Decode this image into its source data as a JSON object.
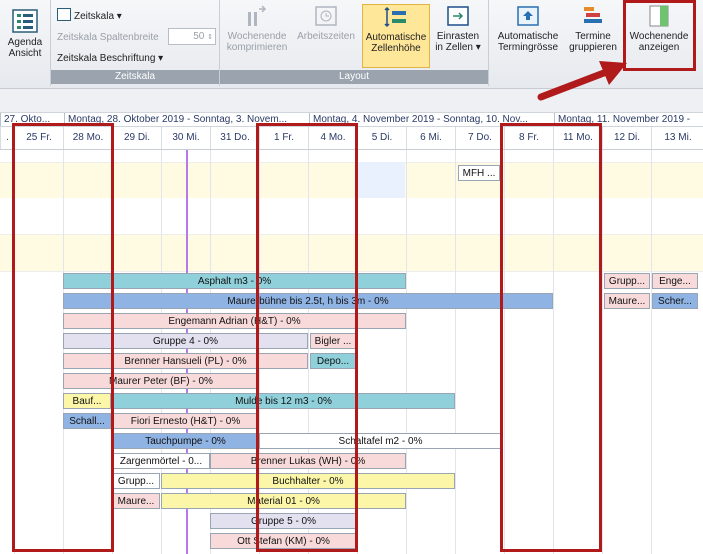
{
  "ribbon": {
    "agenda": {
      "label1": "Agenda",
      "label2": "Ansicht"
    },
    "zeitskala": {
      "menu_label": "Zeitskala",
      "spaltenbreite_label": "Zeitskala Spaltenbreite",
      "spaltenbreite_value": "50",
      "beschriftung_label": "Zeitskala Beschriftung",
      "group_label": "Zeitskala"
    },
    "layout": {
      "group_label": "Layout",
      "buttons": [
        {
          "l1": "Wochenende",
          "l2": "komprimieren"
        },
        {
          "l1": "Arbeitszeiten",
          "l2": ""
        },
        {
          "l1": "Automatische",
          "l2": "Zellenhöhe"
        },
        {
          "l1": "Einrasten",
          "l2": "in Zellen"
        }
      ]
    },
    "more": [
      {
        "l1": "Automatische",
        "l2": "Termingrösse"
      },
      {
        "l1": "Termine",
        "l2": "gruppieren"
      },
      {
        "l1": "Wochenende",
        "l2": "anzeigen"
      }
    ]
  },
  "weeks": [
    {
      "label": "27. Okto..."
    },
    {
      "label": "Montag, 28. Oktober 2019 - Sonntag, 3. Novem..."
    },
    {
      "label": "Montag, 4. November 2019 - Sonntag, 10. Nov..."
    },
    {
      "label": "Montag, 11. November 2019 -"
    }
  ],
  "days": [
    "25 Fr.",
    "28 Mo.",
    "29 Di.",
    "30 Mi.",
    "31 Do.",
    "1 Fr.",
    "4 Mo.",
    "5 Di.",
    "6 Mi.",
    "7 Do.",
    "8 Fr.",
    "11 Mo.",
    "12 Di.",
    "13 Mi."
  ],
  "bars": [
    {
      "text": "MFH ..."
    },
    {
      "text": "Asphalt m3 - 0%"
    },
    {
      "text": "Grupp..."
    },
    {
      "text": "Enge..."
    },
    {
      "text": "Maurerbühne bis 2.5t, h bis 3m - 0%"
    },
    {
      "text": "Maure..."
    },
    {
      "text": "Scher..."
    },
    {
      "text": "Engemann Adrian (H&T) - 0%"
    },
    {
      "text": "Gruppe 4 - 0%"
    },
    {
      "text": "Bigler ..."
    },
    {
      "text": "Brenner Hansueli (PL) - 0%"
    },
    {
      "text": "Depo..."
    },
    {
      "text": "Maurer Peter (BF) - 0%"
    },
    {
      "text": "Bauf..."
    },
    {
      "text": "Mulde bis 12 m3 - 0%"
    },
    {
      "text": "Schall..."
    },
    {
      "text": "Fiori Ernesto (H&T) - 0%"
    },
    {
      "text": "Tauchpumpe - 0%"
    },
    {
      "text": "Schaltafel m2 - 0%"
    },
    {
      "text": "Zargenmörtel - 0..."
    },
    {
      "text": "Brenner Lukas (WH) - 0%"
    },
    {
      "text": "Grupp..."
    },
    {
      "text": "Buchhalter - 0%"
    },
    {
      "text": "Maure..."
    },
    {
      "text": "Material 01 - 0%"
    },
    {
      "text": "Gruppe 5 - 0%"
    },
    {
      "text": "Ott Stefan (KM) - 0%"
    }
  ],
  "colors": {
    "teal": "#8fd0da",
    "blue": "#8fb3e3",
    "pink": "#f8dada",
    "lav": "#e3e1ef",
    "yellow": "#fcf7a8",
    "white": "#ffffff",
    "highlight_red": "#b11a1a"
  }
}
